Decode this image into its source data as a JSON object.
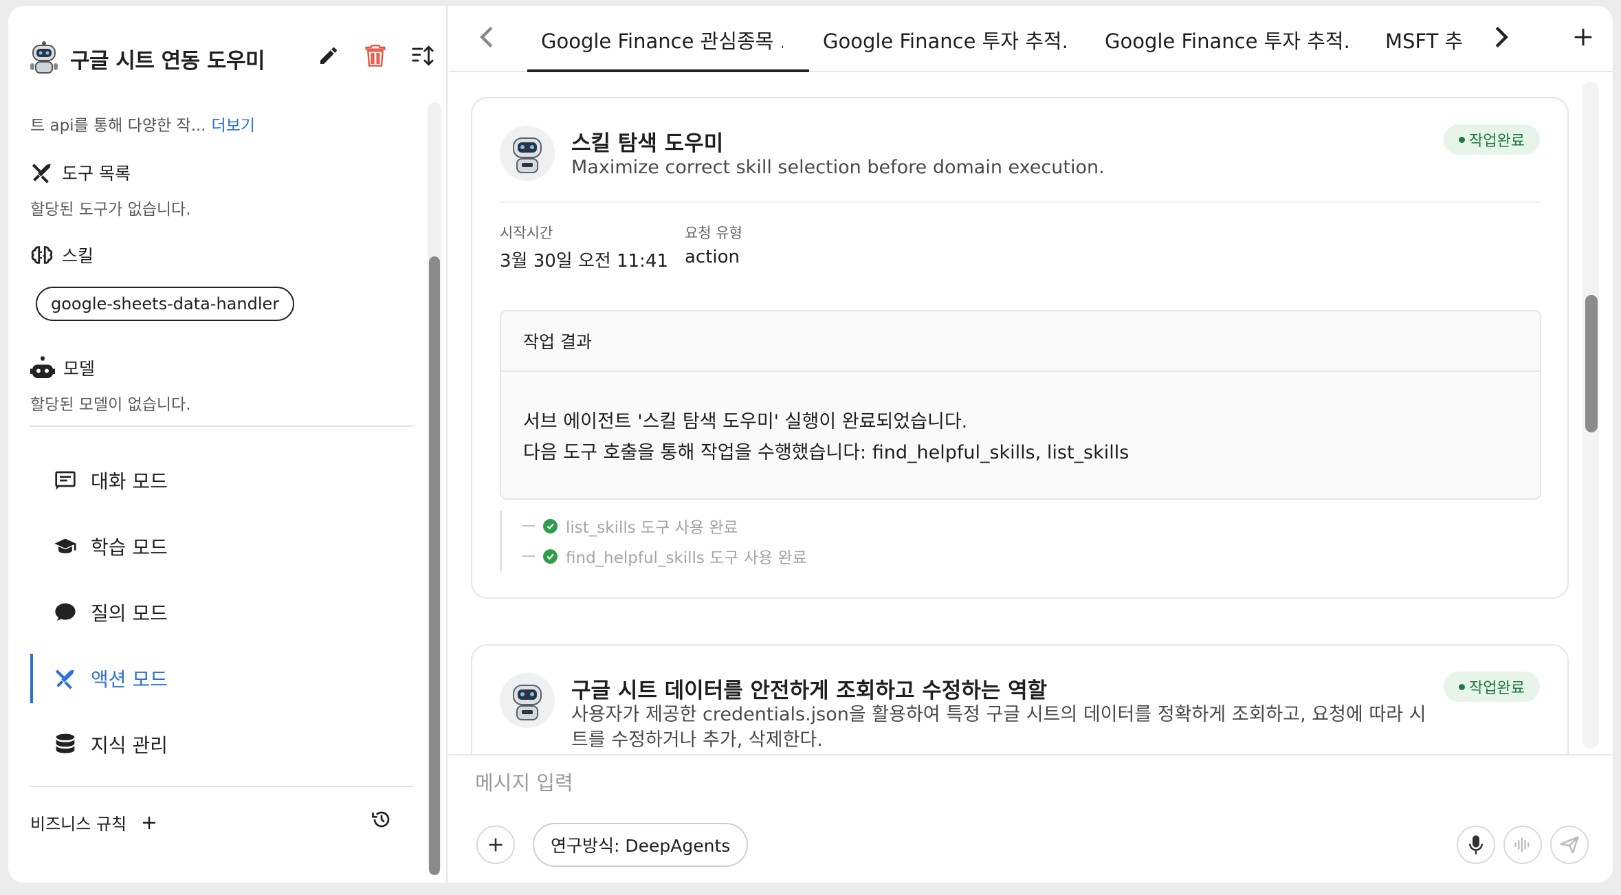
{
  "sidebar": {
    "title": "구글 시트 연동 도우미",
    "description": "트 api를 통해 다양한 작...",
    "more_link": "더보기",
    "tools": {
      "label": "도구 목록",
      "empty": "할당된 도구가 없습니다."
    },
    "skills": {
      "label": "스킬",
      "items": [
        "google-sheets-data-handler"
      ]
    },
    "models": {
      "label": "모델",
      "empty": "할당된 모델이 없습니다."
    },
    "nav": [
      {
        "label": "대화 모드",
        "icon": "chat-icon"
      },
      {
        "label": "학습 모드",
        "icon": "graduation-cap-icon"
      },
      {
        "label": "질의 모드",
        "icon": "speech-bubble-icon"
      },
      {
        "label": "액션 모드",
        "icon": "tools-icon",
        "active": true
      },
      {
        "label": "지식 관리",
        "icon": "database-icon"
      }
    ],
    "business_rules": "비즈니스 규칙"
  },
  "tabs": [
    {
      "label": "Google Finance 관심종목 ...",
      "active": true
    },
    {
      "label": "Google Finance 투자 추적..."
    },
    {
      "label": "Google Finance 투자 추적..."
    },
    {
      "label": "MSFT 추가"
    }
  ],
  "cards": [
    {
      "title": "스킬 탐색 도우미",
      "description": "Maximize correct skill selection before domain execution.",
      "status": "작업완료",
      "start_label": "시작시간",
      "start_value": "3월 30일 오전 11:41",
      "type_label": "요청 유형",
      "type_value": "action",
      "result_title": "작업 결과",
      "result_lines": [
        "서브 에이전트 '스킬 탐색 도우미' 실행이 완료되었습니다.",
        "다음 도구 호출을 통해 작업을 수행했습니다: find_helpful_skills, list_skills"
      ],
      "tool_logs": [
        "list_skills 도구 사용 완료",
        "find_helpful_skills 도구 사용 완료"
      ]
    },
    {
      "title": "구글 시트 데이터를 안전하게 조회하고 수정하는 역할",
      "description": "사용자가 제공한 credentials.json을 활용하여 특정 구글 시트의 데이터를 정확하게 조회하고, 요청에 따라 시트를 수정하거나 추가, 삭제한다.",
      "status": "작업완료"
    }
  ],
  "input": {
    "placeholder": "메시지 입력",
    "research_method": "연구방식: DeepAgents"
  },
  "colors": {
    "accent": "#2c6fd6",
    "success_bg": "#e6f4ea",
    "success_text": "#1e7a3a",
    "danger": "#e8543f"
  }
}
